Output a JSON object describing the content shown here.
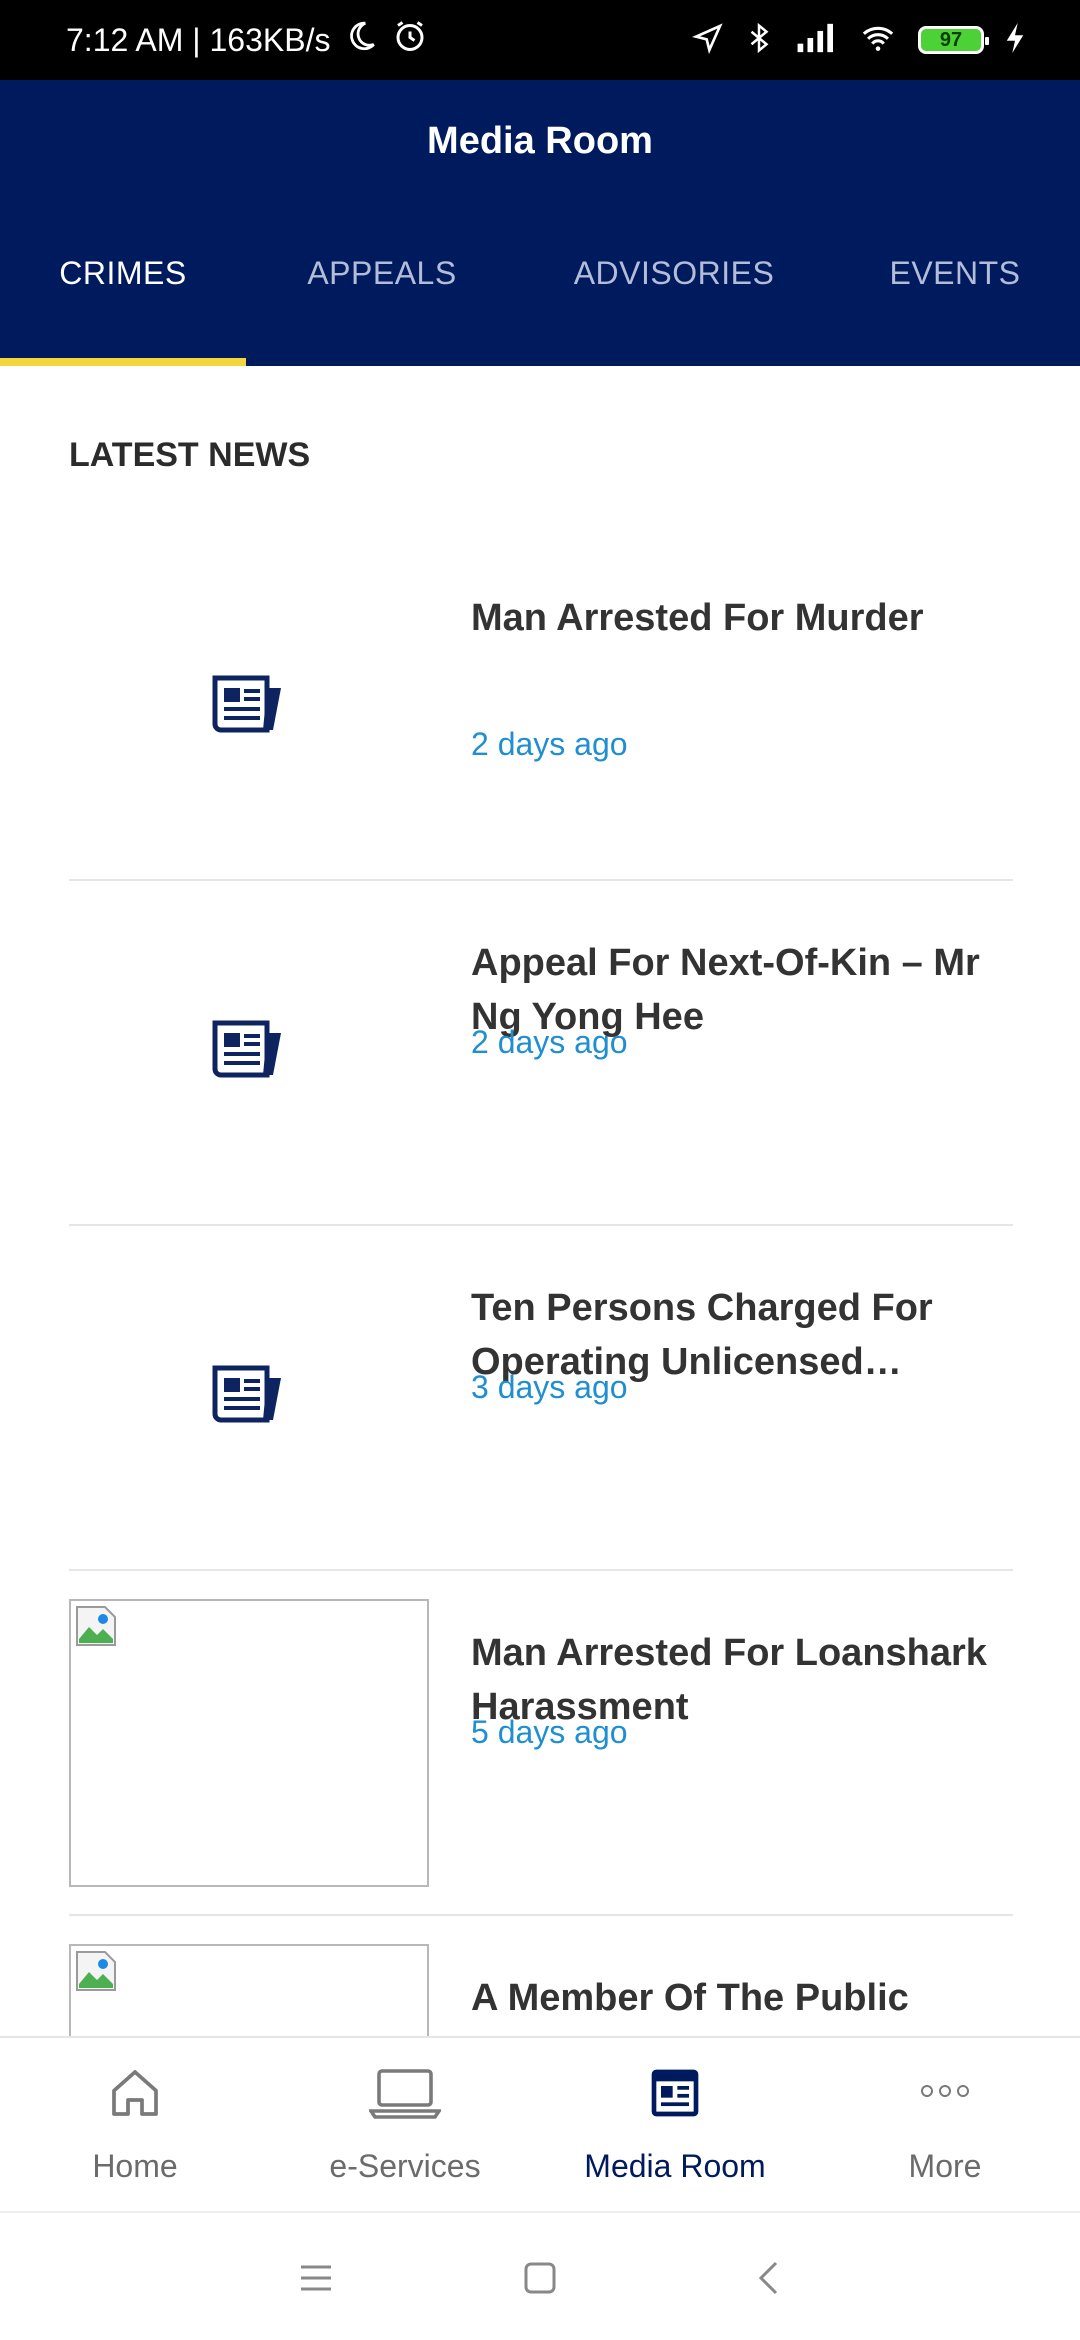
{
  "status_bar": {
    "time_speed": "7:12 AM | 163KB/s",
    "battery": "97"
  },
  "header": {
    "title": "Media Room"
  },
  "tabs": [
    {
      "label": "CRIMES",
      "active": true
    },
    {
      "label": "APPEALS",
      "active": false
    },
    {
      "label": "ADVISORIES",
      "active": false
    },
    {
      "label": "EVENTS",
      "active": false
    }
  ],
  "section": {
    "title": "LATEST NEWS"
  },
  "news": [
    {
      "title": "Man Arrested For Murder",
      "time": "2 days ago",
      "thumb": "newspaper-icon"
    },
    {
      "title": "Appeal For Next-Of-Kin – Mr Ng Yong Hee",
      "time": "2 days ago",
      "thumb": "newspaper-icon"
    },
    {
      "title": "Ten Persons Charged For Operating Unlicensed Massa…",
      "time": "3 days ago",
      "thumb": "newspaper-icon"
    },
    {
      "title": "Man Arrested For Loanshark Harassment",
      "time": "5 days ago",
      "thumb": "broken-image"
    },
    {
      "title": "A Member Of The Public Presented With Public …",
      "time": "",
      "thumb": "broken-image"
    }
  ],
  "bottom_nav": [
    {
      "label": "Home",
      "icon": "home-icon",
      "active": false
    },
    {
      "label": "e-Services",
      "icon": "laptop-icon",
      "active": false
    },
    {
      "label": "Media Room",
      "icon": "newspaper-icon",
      "active": true
    },
    {
      "label": "More",
      "icon": "more-icon",
      "active": false
    }
  ],
  "colors": {
    "header_bg": "#001a5e",
    "tab_indicator": "#f5d53c",
    "time_text": "#1f8fd1"
  }
}
